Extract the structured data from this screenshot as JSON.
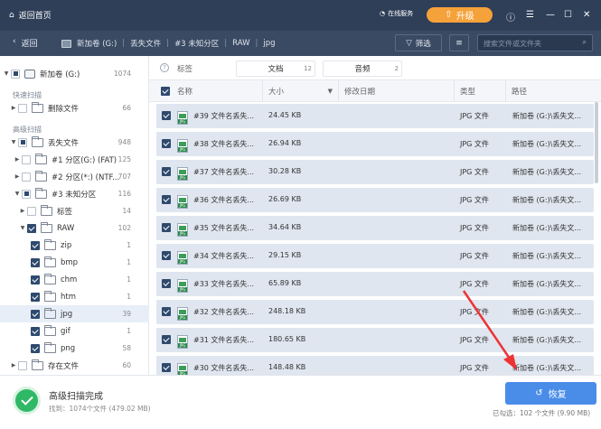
{
  "titlebar": {
    "home_label": "返回首页",
    "service_label": "在线服务",
    "upgrade_label": "升级"
  },
  "nav": {
    "back_label": "返回",
    "crumbs": [
      "新加卷 (G:)",
      "丢失文件",
      "#3 未知分区",
      "RAW",
      "jpg"
    ],
    "filter_label": "筛选",
    "search_placeholder": "搜索文件或文件夹"
  },
  "sidebar": {
    "root": {
      "label": "新加卷 (G:)",
      "count": "1074"
    },
    "quick_scan_label": "快速扫描",
    "deleted": {
      "label": "删除文件",
      "count": "66"
    },
    "advanced_scan_label": "高级扫描",
    "lost": {
      "label": "丢失文件",
      "count": "948"
    },
    "part1": {
      "label": "#1 分区(G:) (FAT)",
      "count": "125"
    },
    "part2": {
      "label": "#2 分区(*:) (NTF...",
      "count": "707"
    },
    "part3": {
      "label": "#3 未知分区",
      "count": "116"
    },
    "tags": {
      "label": "标签",
      "count": "14"
    },
    "raw": {
      "label": "RAW",
      "count": "102"
    },
    "sub": [
      {
        "label": "zip",
        "count": "1"
      },
      {
        "label": "bmp",
        "count": "1"
      },
      {
        "label": "chm",
        "count": "1"
      },
      {
        "label": "htm",
        "count": "1"
      },
      {
        "label": "jpg",
        "count": "39"
      },
      {
        "label": "gif",
        "count": "1"
      },
      {
        "label": "png",
        "count": "58"
      }
    ],
    "existing": {
      "label": "存在文件",
      "count": "60"
    }
  },
  "typebar": {
    "label": "标签",
    "tabs": [
      {
        "label": "文档",
        "count": "12"
      },
      {
        "label": "音频",
        "count": "2"
      }
    ]
  },
  "table": {
    "headers": {
      "name": "名称",
      "size": "大小",
      "modified": "修改日期",
      "type": "类型",
      "path": "路径"
    },
    "rows": [
      {
        "name": "#39 文件名丢失...",
        "size": "24.45 KB",
        "type": "JPG 文件",
        "path": "新加卷 (G:)\\丢失文..."
      },
      {
        "name": "#38 文件名丢失...",
        "size": "26.94 KB",
        "type": "JPG 文件",
        "path": "新加卷 (G:)\\丢失文..."
      },
      {
        "name": "#37 文件名丢失...",
        "size": "30.28 KB",
        "type": "JPG 文件",
        "path": "新加卷 (G:)\\丢失文..."
      },
      {
        "name": "#36 文件名丢失...",
        "size": "26.69 KB",
        "type": "JPG 文件",
        "path": "新加卷 (G:)\\丢失文..."
      },
      {
        "name": "#35 文件名丢失...",
        "size": "34.64 KB",
        "type": "JPG 文件",
        "path": "新加卷 (G:)\\丢失文..."
      },
      {
        "name": "#34 文件名丢失...",
        "size": "29.15 KB",
        "type": "JPG 文件",
        "path": "新加卷 (G:)\\丢失文..."
      },
      {
        "name": "#33 文件名丢失...",
        "size": "65.89 KB",
        "type": "JPG 文件",
        "path": "新加卷 (G:)\\丢失文..."
      },
      {
        "name": "#32 文件名丢失...",
        "size": "248.18 KB",
        "type": "JPG 文件",
        "path": "新加卷 (G:)\\丢失文..."
      },
      {
        "name": "#31 文件名丢失...",
        "size": "180.65 KB",
        "type": "JPG 文件",
        "path": "新加卷 (G:)\\丢失文..."
      },
      {
        "name": "#30 文件名丢失...",
        "size": "148.48 KB",
        "type": "JPG 文件",
        "path": "新加卷 (G:)\\丢失文..."
      }
    ]
  },
  "footer": {
    "status_title": "高级扫描完成",
    "found_text": "找到：1074个文件 (479.02 MB)",
    "restore_label": "恢复",
    "selected_text": "已勾选：102 个文件 (9.90 MB)"
  }
}
